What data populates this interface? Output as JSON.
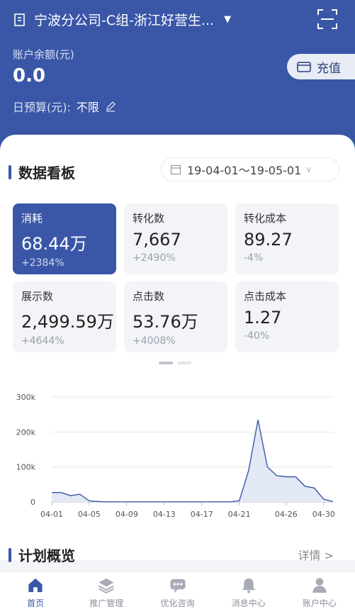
{
  "header": {
    "account_name": "宁波分公司-C组-浙江好营生...",
    "balance_label": "账户余额(元)",
    "balance_value": "0.0",
    "budget_label": "日预算(元):",
    "budget_value": "不限",
    "recharge_label": "充值"
  },
  "dashboard": {
    "title": "数据看板",
    "date_range": "19-04-01～19-05-01",
    "metrics": [
      {
        "label": "消耗",
        "value": "68.44万",
        "change": "+2384%"
      },
      {
        "label": "转化数",
        "value": "7,667",
        "change": "+2490%"
      },
      {
        "label": "转化成本",
        "value": "89.27",
        "change": "-4%"
      },
      {
        "label": "展示数",
        "value": "2,499.59万",
        "change": "+4644%"
      },
      {
        "label": "点击数",
        "value": "53.76万",
        "change": "+4008%"
      },
      {
        "label": "点击成本",
        "value": "1.27",
        "change": "-40%"
      }
    ]
  },
  "chart_data": {
    "type": "area",
    "x": [
      "04-01",
      "04-02",
      "04-03",
      "04-04",
      "04-05",
      "04-06",
      "04-07",
      "04-08",
      "04-09",
      "04-10",
      "04-11",
      "04-12",
      "04-13",
      "04-14",
      "04-15",
      "04-16",
      "04-17",
      "04-18",
      "04-19",
      "04-20",
      "04-21",
      "04-22",
      "04-23",
      "04-24",
      "04-25",
      "04-26",
      "04-27",
      "04-28",
      "04-29",
      "04-30",
      "05-01"
    ],
    "xticks": [
      "04-01",
      "04-05",
      "04-09",
      "04-13",
      "04-17",
      "04-21",
      "04-26",
      "04-30"
    ],
    "yticks": [
      "0",
      "100k",
      "200k",
      "300k"
    ],
    "ylim": [
      0,
      300000
    ],
    "values": [
      27000,
      27000,
      18000,
      22000,
      3000,
      1000,
      500,
      500,
      500,
      500,
      500,
      500,
      500,
      500,
      500,
      500,
      500,
      500,
      500,
      500,
      3000,
      90000,
      235000,
      100000,
      75000,
      72000,
      72000,
      45000,
      40000,
      8000,
      1000
    ],
    "colors": {
      "line": "#3a57a7",
      "fill": "#e3e8f5"
    }
  },
  "plan": {
    "title": "计划概览",
    "more_label": "详情 >"
  },
  "tabbar": [
    {
      "label": "首页",
      "icon": "home-icon"
    },
    {
      "label": "推广管理",
      "icon": "layers-icon"
    },
    {
      "label": "优化咨询",
      "icon": "chat-icon"
    },
    {
      "label": "消息中心",
      "icon": "bell-icon"
    },
    {
      "label": "账户中心",
      "icon": "user-icon"
    }
  ]
}
